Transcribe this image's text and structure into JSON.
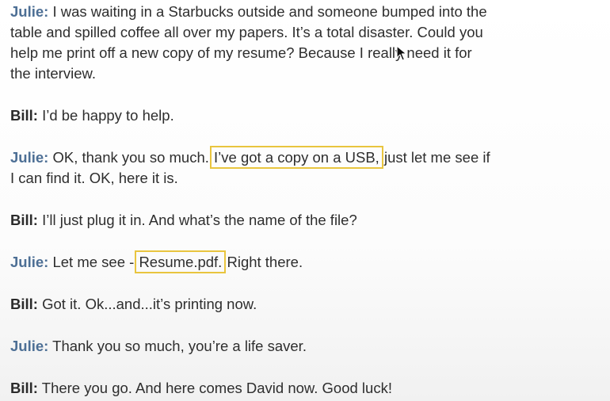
{
  "speakers": {
    "julie": "Julie:",
    "bill": "Bill:"
  },
  "lines": {
    "l1": "I was waiting in a Starbucks outside and someone bumped into the",
    "l2": "table and spilled coffee all over my papers. It’s a total disaster. Could you",
    "l3": "help me print off a new copy of my resume? Because I really need it for",
    "l4": "the interview.",
    "l5": "I’d be happy to help.",
    "l6a": "OK, thank you so much.",
    "l6hl": "I’ve got a copy on a USB,",
    "l6b": "just let me see if",
    "l7": "I can find it. OK, here it is.",
    "l8": "I’ll just plug it in. And what’s the name of the file?",
    "l9a": "Let me see -",
    "l9hl": "Resume.pdf.",
    "l9b": "Right there.",
    "l10": "Got it. Ok...and...it’s printing now.",
    "l11": "Thank you so much, you’re a life saver.",
    "l12": "There you go. And here comes David now. Good luck!"
  },
  "colors": {
    "julie": "#4d6f95",
    "bill": "#2b2b2b",
    "highlight_border": "#e9c53f"
  },
  "icons": {
    "cursor": "mouse-pointer-icon"
  }
}
